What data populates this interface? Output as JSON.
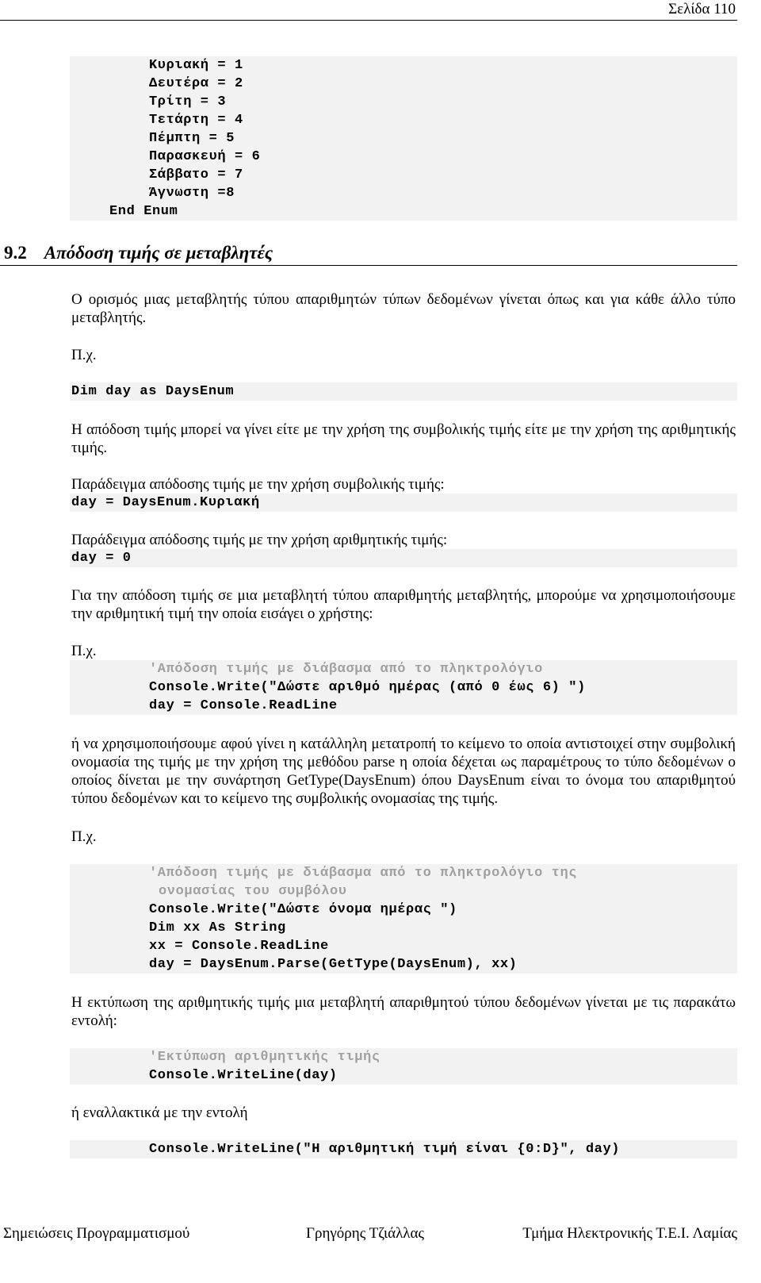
{
  "header": {
    "page": "Σελίδα 110"
  },
  "code_enum": {
    "lines": [
      "Κυριακή = 1",
      "Δευτέρα = 2",
      "Τρίτη = 3",
      "Τετάρτη = 4",
      "Πέμπτη = 5",
      "Παρασκευή = 6",
      "Σάββατο = 7",
      "Άγνωστη =8"
    ],
    "end": "End Enum"
  },
  "section": {
    "number": "9.2",
    "title": "Απόδοση τιμής σε μεταβλητές"
  },
  "p1": "Ο ορισμός μιας μεταβλητής τύπου απαριθμητών τύπων δεδομένων γίνεται όπως και για κάθε άλλο τύπο μεταβλητής.",
  "eg": "Π.χ.",
  "code_dim": "Dim day as DaysEnum",
  "p2": "Η απόδοση τιμής μπορεί να γίνει είτε με την χρήση της συμβολικής τιμής είτε με την χρήση της αριθμητικής τιμής.",
  "p3": "Παράδειγμα απόδοσης τιμής με την χρήση συμβολικής τιμής:",
  "code_sym": "day = DaysEnum.Κυριακή",
  "p4": "Παράδειγμα απόδοσης τιμής με την χρήση αριθμητικής τιμής:",
  "code_num": "day = 0",
  "p5": "Για την απόδοση τιμής σε μια μεταβλητή τύπου απαριθμητής μεταβλητής, μπορούμε να χρησιμοποιήσουμε την αριθμητική τιμή την οποία εισάγει ο χρήστης:",
  "code_read": {
    "comment": "'Απόδοση τιμής με διάβασμα από το πληκτρολόγιο",
    "l1": "Console.Write(\"Δώστε αριθμό ημέρας (από 0 έως 6) \")",
    "l2": "day = Console.ReadLine"
  },
  "p6": "ή να χρησιμοποιήσουμε αφού γίνει η κατάλληλη μετατροπή το κείμενο το οποία αντιστοιχεί στην συμβολική ονομασία της τιμής με την χρήση της μεθόδου parse  η οποία δέχεται ως παραμέτρους το τύπο δεδομένων ο οποίος δίνεται με την συνάρτηση GetType(DaysEnum) όπου DaysEnum είναι το όνομα του απαριθμητού τύπου δεδομένων και το κείμενο της συμβολικής ονομασίας της τιμής.",
  "code_parse": {
    "comment1": "'Απόδοση τιμής με διάβασμα από το πληκτρολόγιο της",
    "comment2": "ονομασίας του συμβόλου",
    "l1": "Console.Write(\"Δώστε όνομα ημέρας \")",
    "l2": "Dim xx As String",
    "l3": "xx = Console.ReadLine",
    "l4": "day = DaysEnum.Parse(GetType(DaysEnum), xx)"
  },
  "p7": "Η εκτύπωση της αριθμητικής τιμής μια μεταβλητή απαριθμητού τύπου δεδομένων γίνεται με τις παρακάτω εντολή:",
  "code_print": {
    "comment": "'Εκτύπωση αριθμητικής τιμής",
    "l1": "Console.WriteLine(day)"
  },
  "p8": "ή εναλλακτικά με την εντολή",
  "code_print2": "Console.WriteLine(\"Η αριθμητική τιμή είναι {0:D}\", day)",
  "footer": {
    "left": "Σημειώσεις Προγραμματισμού",
    "center": "Γρηγόρης Τζιάλλας",
    "right": "Τμήμα Ηλεκτρονικής Τ.Ε.Ι. Λαμίας"
  }
}
